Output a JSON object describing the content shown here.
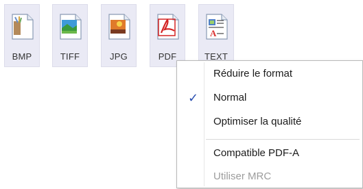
{
  "formats": [
    {
      "label": "BMP",
      "icon": "bmp-file-icon"
    },
    {
      "label": "TIFF",
      "icon": "tiff-file-icon"
    },
    {
      "label": "JPG",
      "icon": "jpg-file-icon"
    },
    {
      "label": "PDF",
      "icon": "pdf-file-icon"
    },
    {
      "label": "TEXT",
      "icon": "text-file-icon"
    }
  ],
  "menu": {
    "items": [
      {
        "label": "Réduire le format",
        "checked": false,
        "enabled": true
      },
      {
        "label": "Normal",
        "checked": true,
        "enabled": true
      },
      {
        "label": "Optimiser la qualité",
        "checked": false,
        "enabled": true
      },
      {
        "label": "Compatible PDF-A",
        "checked": false,
        "enabled": true
      },
      {
        "label": "Utiliser MRC",
        "checked": false,
        "enabled": false
      }
    ],
    "check_glyph": "✓"
  },
  "colors": {
    "tile_bg": "#eaeaf5",
    "check": "#2a4fb0",
    "pdf_red": "#d32222"
  }
}
